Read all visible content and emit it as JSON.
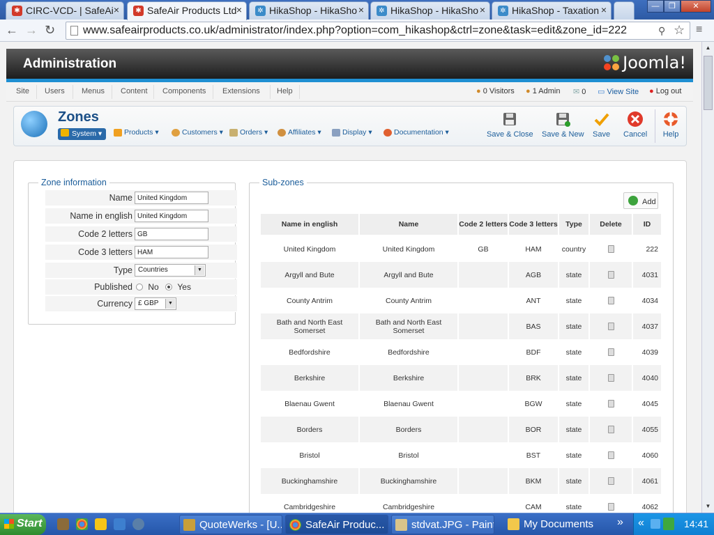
{
  "browser": {
    "tabs": [
      {
        "label": "CIRC-VCD- | SafeAi",
        "icon": "joomla-favicon",
        "active": false
      },
      {
        "label": "SafeAir Products Ltd",
        "icon": "joomla-favicon",
        "active": true
      },
      {
        "label": "HikaShop - HikaSho",
        "icon": "hikashop-favicon",
        "active": false
      },
      {
        "label": "HikaShop - HikaSho",
        "icon": "hikashop-favicon",
        "active": false
      },
      {
        "label": "HikaShop - Taxation",
        "icon": "hikashop-favicon",
        "active": false
      }
    ],
    "url": "www.safeairproducts.co.uk/administrator/index.php?option=com_hikashop&ctrl=zone&task=edit&zone_id=222"
  },
  "header": {
    "title": "Administration",
    "logo": "Joomla!"
  },
  "menu": {
    "items": [
      "Site",
      "Users",
      "Menus",
      "Content",
      "Components",
      "Extensions",
      "Help"
    ],
    "status": {
      "visitors": "0 Visitors",
      "admins": "1 Admin",
      "messages": "0",
      "view_site": "View Site",
      "logout": "Log out"
    }
  },
  "page": {
    "title": "Zones",
    "submenu": [
      "System",
      "Products",
      "Customers",
      "Orders",
      "Affiliates",
      "Display",
      "Documentation"
    ],
    "toolbar": {
      "save_close": "Save & Close",
      "save_new": "Save & New",
      "save": "Save",
      "cancel": "Cancel",
      "help": "Help"
    }
  },
  "zone_info": {
    "legend": "Zone information",
    "name_label": "Name",
    "name": "United Kingdom",
    "name_english_label": "Name in english",
    "name_english": "United Kingdom",
    "code2_label": "Code 2 letters",
    "code2": "GB",
    "code3_label": "Code 3 letters",
    "code3": "HAM",
    "type_label": "Type",
    "type": "Countries",
    "published_label": "Published",
    "published_no": "No",
    "published_yes": "Yes",
    "published_value": "Yes",
    "currency_label": "Currency",
    "currency": "£ GBP"
  },
  "subzones": {
    "legend": "Sub-zones",
    "add_label": "Add",
    "columns": [
      "Name in english",
      "Name",
      "Code 2 letters",
      "Code 3 letters",
      "Type",
      "Delete",
      "ID"
    ],
    "rows": [
      {
        "name_en": "United Kingdom",
        "name": "United Kingdom",
        "code2": "GB",
        "code3": "HAM",
        "type": "country",
        "id": "222"
      },
      {
        "name_en": "Argyll and Bute",
        "name": "Argyll and Bute",
        "code2": "",
        "code3": "AGB",
        "type": "state",
        "id": "4031"
      },
      {
        "name_en": "County Antrim",
        "name": "County Antrim",
        "code2": "",
        "code3": "ANT",
        "type": "state",
        "id": "4034"
      },
      {
        "name_en": "Bath and North East Somerset",
        "name": "Bath and North East Somerset",
        "code2": "",
        "code3": "BAS",
        "type": "state",
        "id": "4037"
      },
      {
        "name_en": "Bedfordshire",
        "name": "Bedfordshire",
        "code2": "",
        "code3": "BDF",
        "type": "state",
        "id": "4039"
      },
      {
        "name_en": "Berkshire",
        "name": "Berkshire",
        "code2": "",
        "code3": "BRK",
        "type": "state",
        "id": "4040"
      },
      {
        "name_en": "Blaenau Gwent",
        "name": "Blaenau Gwent",
        "code2": "",
        "code3": "BGW",
        "type": "state",
        "id": "4045"
      },
      {
        "name_en": "Borders",
        "name": "Borders",
        "code2": "",
        "code3": "BOR",
        "type": "state",
        "id": "4055"
      },
      {
        "name_en": "Bristol",
        "name": "Bristol",
        "code2": "",
        "code3": "BST",
        "type": "state",
        "id": "4060"
      },
      {
        "name_en": "Buckinghamshire",
        "name": "Buckinghamshire",
        "code2": "",
        "code3": "BKM",
        "type": "state",
        "id": "4061"
      },
      {
        "name_en": "Cambridgeshire",
        "name": "Cambridgeshire",
        "code2": "",
        "code3": "CAM",
        "type": "state",
        "id": "4062"
      }
    ]
  },
  "taskbar": {
    "start": "Start",
    "tasks": [
      {
        "label": "QuoteWerks - [U...",
        "active": false
      },
      {
        "label": "SafeAir Produc...",
        "active": true
      },
      {
        "label": "stdvat.JPG - Paint",
        "active": false
      },
      {
        "label": "My Documents",
        "active": false
      }
    ],
    "overflow": "»",
    "tray_expand": "«",
    "clock": "14:41"
  },
  "colors": {
    "accent": "#1f8fd2",
    "link": "#1b5d9a",
    "header_dark": "#1d1d1d",
    "save_check": "#f0a000",
    "cancel_red": "#e03a2b"
  }
}
